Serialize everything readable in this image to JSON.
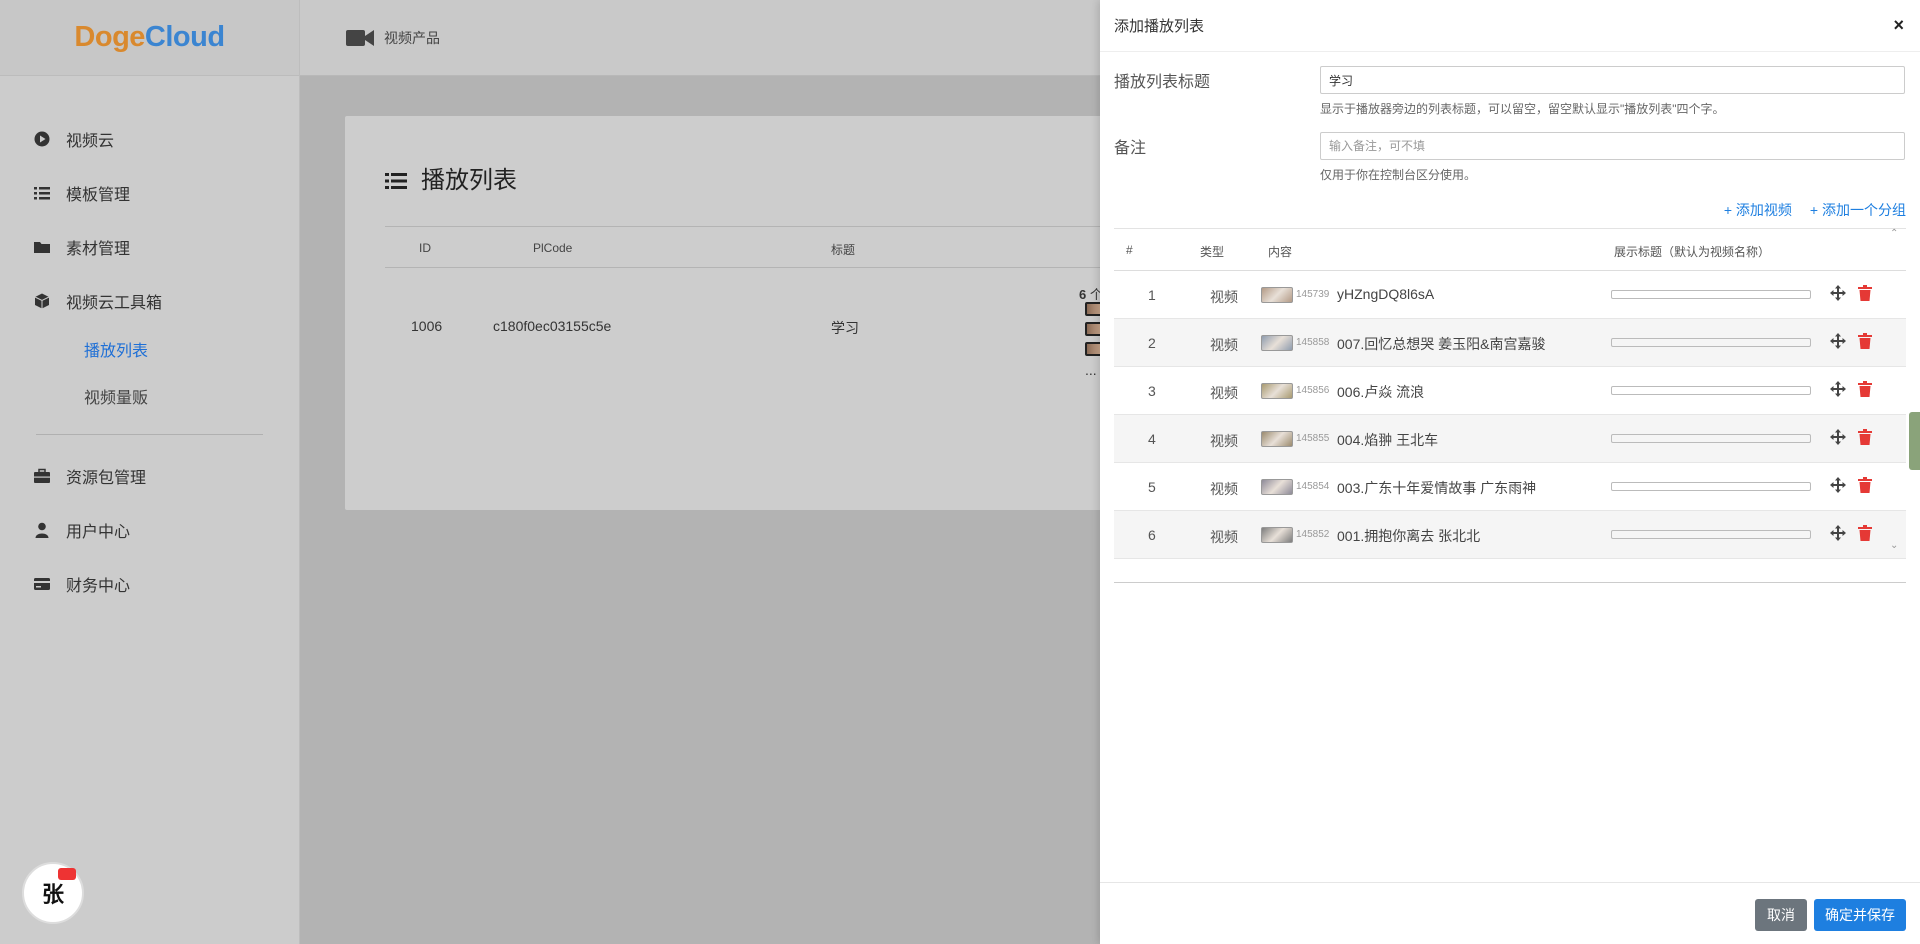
{
  "brand": {
    "logo_part1": "Doge",
    "logo_part2": "Cloud"
  },
  "sidebar": {
    "items": [
      {
        "label": "视频云",
        "icon": "play-circle-icon"
      },
      {
        "label": "模板管理",
        "icon": "list-icon"
      },
      {
        "label": "素材管理",
        "icon": "folder-icon"
      },
      {
        "label": "视频云工具箱",
        "icon": "cube-icon"
      }
    ],
    "sub_items": [
      {
        "label": "播放列表",
        "active": true
      },
      {
        "label": "视频量贩",
        "active": false
      }
    ],
    "items2": [
      {
        "label": "资源包管理",
        "icon": "briefcase-icon"
      },
      {
        "label": "用户中心",
        "icon": "user-icon"
      },
      {
        "label": "财务中心",
        "icon": "credit-card-icon"
      }
    ],
    "avatar_text": "张"
  },
  "header": {
    "breadcrumb": "视频产品",
    "icon": "video-camera-icon"
  },
  "main": {
    "title": "播放列表",
    "columns": [
      "ID",
      "PlCode",
      "标题"
    ],
    "rows": [
      {
        "id": "1006",
        "code": "c180f0ec03155c5e",
        "title": "学习",
        "count_num": "6",
        "count_text": "个视频",
        "more": "..."
      }
    ]
  },
  "drawer": {
    "title": "添加播放列表",
    "close": "×",
    "form": {
      "title_label": "播放列表标题",
      "title_value": "学习",
      "title_help": "显示于播放器旁边的列表标题，可以留空，留空默认显示\"播放列表\"四个字。",
      "note_label": "备注",
      "note_placeholder": "输入备注，可不填",
      "note_help": "仅用于你在控制台区分使用。"
    },
    "add_video": "+ 添加视频",
    "add_group": "+ 添加一个分组",
    "table": {
      "headers": [
        "#",
        "类型",
        "内容",
        "展示标题（默认为视频名称）"
      ],
      "rows": [
        {
          "num": "1",
          "type": "视频",
          "vid": "145739",
          "name": "yHZngDQ8l6sA",
          "thumb": "#b39a86"
        },
        {
          "num": "2",
          "type": "视频",
          "vid": "145858",
          "name": "007.回忆总想哭 姜玉阳&南宫嘉骏",
          "thumb": "#8f9cae"
        },
        {
          "num": "3",
          "type": "视频",
          "vid": "145856",
          "name": "006.卢焱 流浪",
          "thumb": "#a89a70"
        },
        {
          "num": "4",
          "type": "视频",
          "vid": "145855",
          "name": "004.焰翀 王北车",
          "thumb": "#9b8b6e"
        },
        {
          "num": "5",
          "type": "视频",
          "vid": "145854",
          "name": "003.广东十年爱情故事 广东雨神",
          "thumb": "#8e8a98"
        },
        {
          "num": "6",
          "type": "视频",
          "vid": "145852",
          "name": "001.拥抱你离去 张北北",
          "thumb": "#7d7d7d"
        }
      ]
    },
    "buttons": {
      "cancel": "取消",
      "save": "确定并保存"
    }
  },
  "colors": {
    "accent": "#1e7fe0",
    "danger": "#e53935",
    "active_nav": "#1e6fd6"
  }
}
